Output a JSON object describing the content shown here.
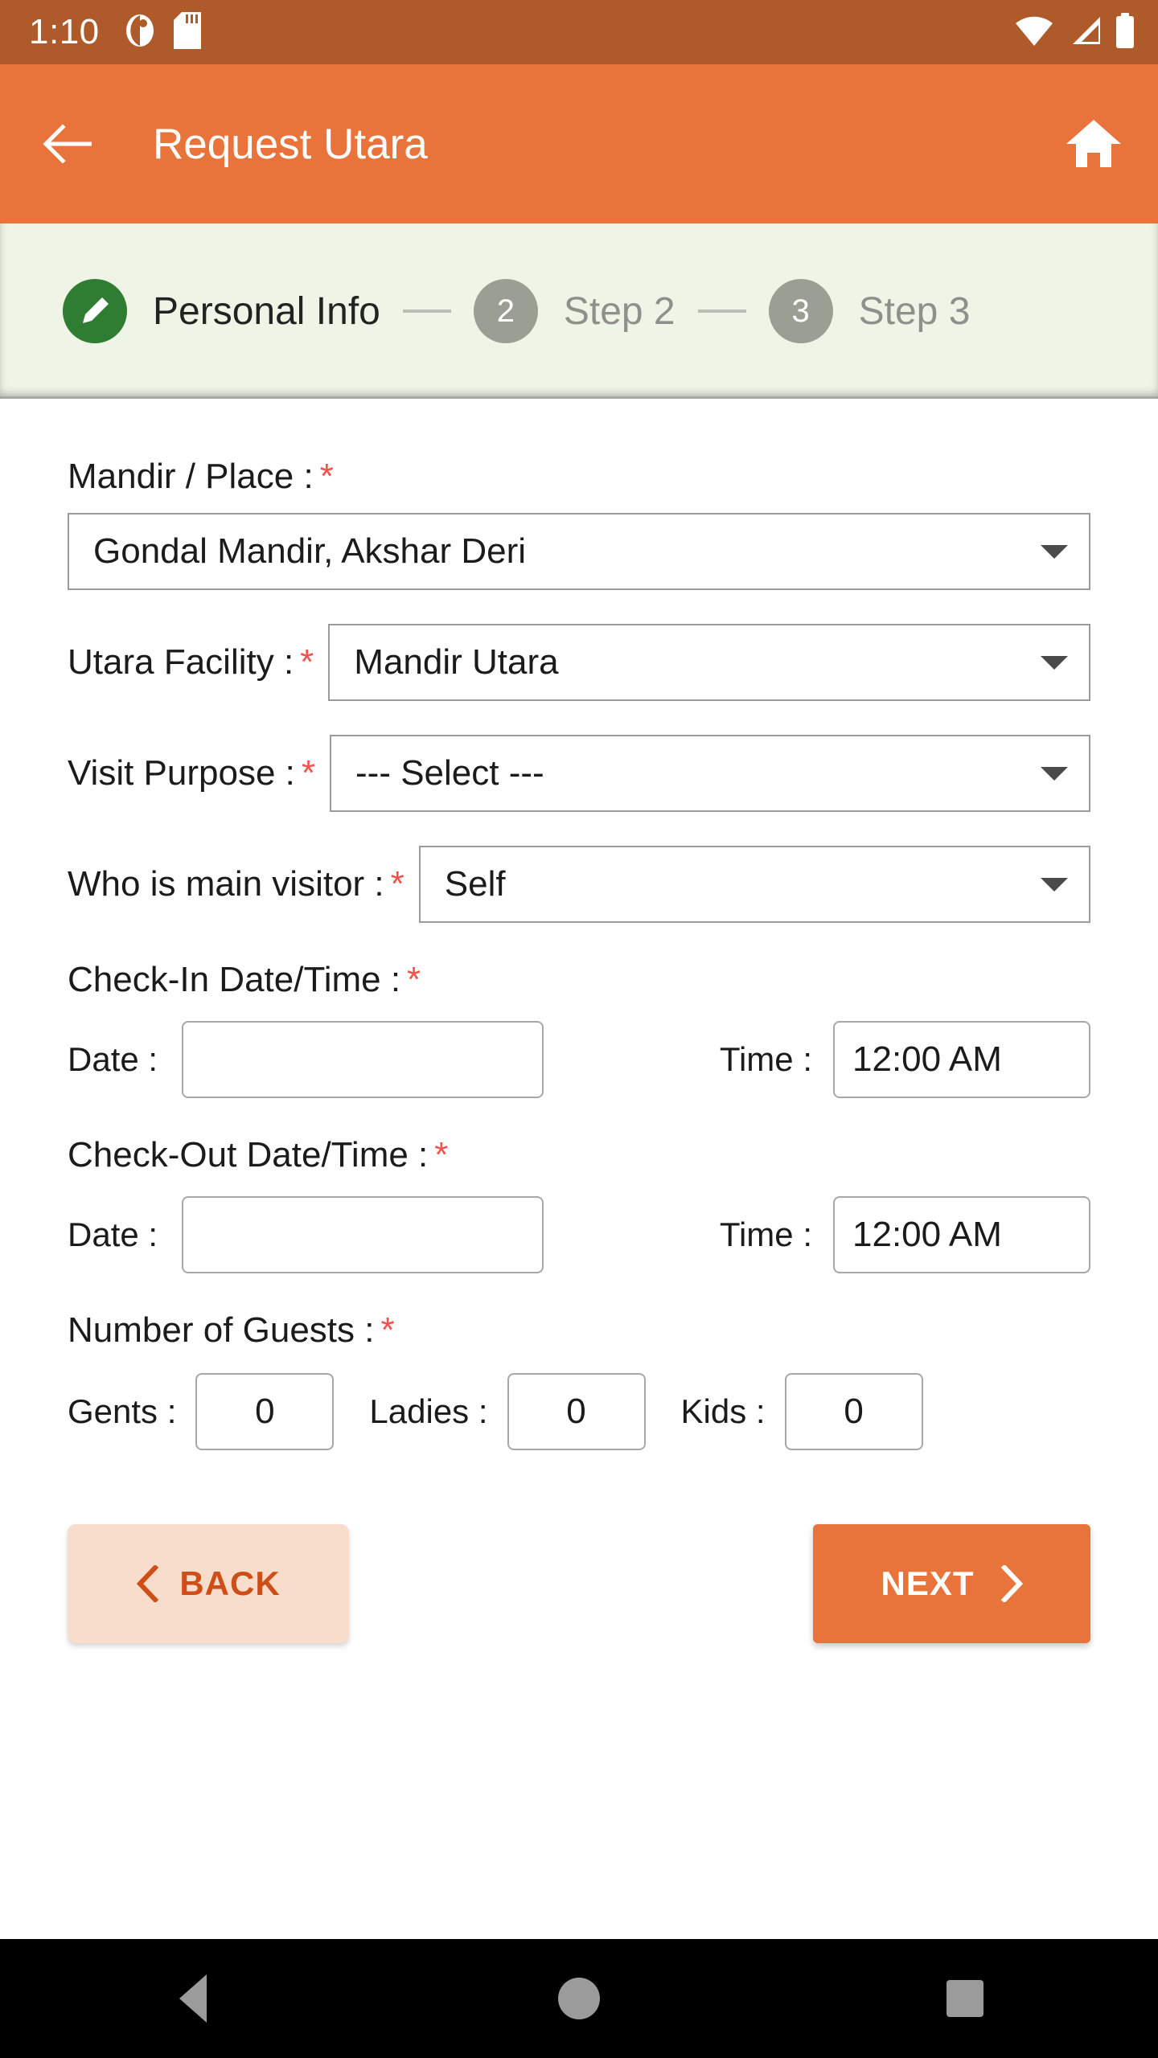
{
  "status_bar": {
    "clock": "1:10",
    "left_icons": [
      "app-notification-icon",
      "sd-card-icon"
    ],
    "right_icons": [
      "wifi-icon",
      "cellular-signal-icon",
      "battery-icon"
    ],
    "background_color": "#ae5a2b"
  },
  "app_bar": {
    "title": "Request Utara",
    "back_icon": "arrow-left-icon",
    "home_icon": "home-icon",
    "background_color": "#e8743b"
  },
  "stepper": {
    "background_color": "#eff5e6",
    "active_color": "#2f7d32",
    "inactive_color": "#9a9e93",
    "steps": [
      {
        "marker": "pencil-icon",
        "label": "Personal Info",
        "state": "active"
      },
      {
        "marker": "2",
        "label": "Step 2",
        "state": "inactive"
      },
      {
        "marker": "3",
        "label": "Step 3",
        "state": "inactive"
      }
    ]
  },
  "form": {
    "required_marker": "*",
    "required_color": "#f3524c",
    "mandir": {
      "label": "Mandir / Place :",
      "value": "Gondal Mandir, Akshar Deri",
      "caret_icon": "chevron-down-icon"
    },
    "utara_facility": {
      "label": "Utara Facility :",
      "value": "Mandir Utara",
      "caret_icon": "chevron-down-icon"
    },
    "visit_purpose": {
      "label": "Visit Purpose :",
      "value": "--- Select ---",
      "caret_icon": "chevron-down-icon"
    },
    "main_visitor": {
      "label": "Who is main visitor :",
      "value": "Self",
      "caret_icon": "chevron-down-icon"
    },
    "check_in": {
      "heading": "Check-In Date/Time :",
      "date_label": "Date :",
      "date_value": "",
      "date_placeholder": "",
      "time_label": "Time :",
      "time_value": "12:00 AM"
    },
    "check_out": {
      "heading": "Check-Out Date/Time :",
      "date_label": "Date :",
      "date_value": "",
      "date_placeholder": "",
      "time_label": "Time :",
      "time_value": "12:00 AM"
    },
    "guests": {
      "heading": "Number of Guests :",
      "gents_label": "Gents :",
      "gents_value": "0",
      "ladies_label": "Ladies :",
      "ladies_value": "0",
      "kids_label": "Kids :",
      "kids_value": "0"
    }
  },
  "actions": {
    "back_label": "BACK",
    "back_icon": "chevron-left-icon",
    "back_bg": "#f8dccc",
    "back_fg": "#cf4e18",
    "next_label": "NEXT",
    "next_icon": "chevron-right-icon",
    "next_bg": "#e8743b",
    "next_fg": "#ffffff"
  },
  "nav_bar": {
    "background_color": "#000000",
    "buttons": [
      {
        "icon": "nav-back-triangle-icon"
      },
      {
        "icon": "nav-home-circle-icon"
      },
      {
        "icon": "nav-recents-square-icon"
      }
    ]
  }
}
